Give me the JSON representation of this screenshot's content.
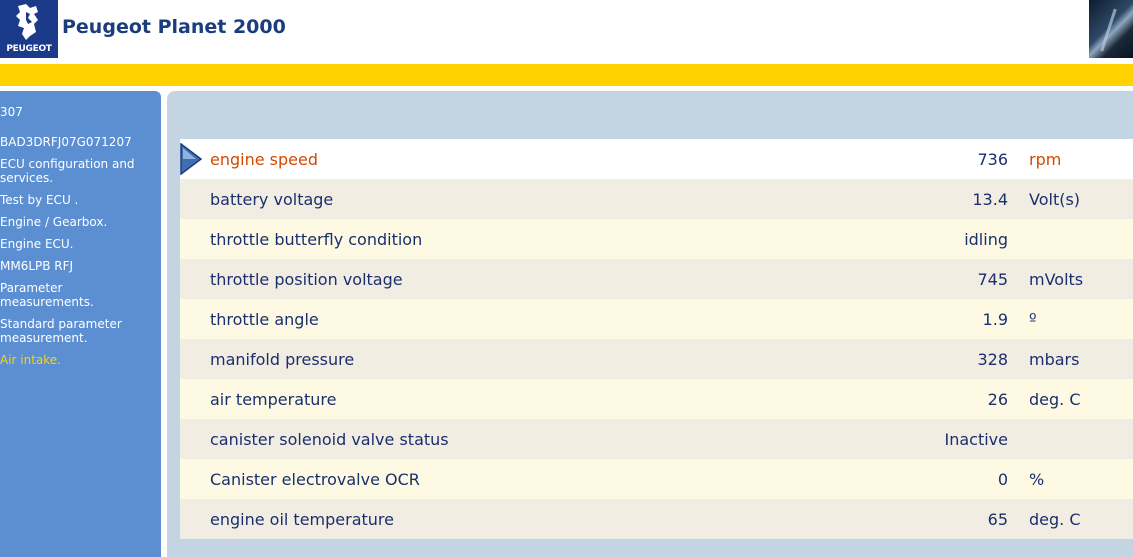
{
  "header": {
    "logo_text": "PEUGEOT",
    "title": "Peugeot Planet 2000"
  },
  "colors": {
    "accent_yellow": "#ffd200",
    "sidebar_blue": "#5b8fd2",
    "panel_blue": "#c3d5e3",
    "highlight": "#d04a00",
    "text_navy": "#1a2f6e"
  },
  "sidebar": {
    "items": [
      {
        "label": "307"
      },
      {
        "label": "BAD3DRFJ07G071207"
      },
      {
        "label": "ECU configuration and services."
      },
      {
        "label": "Test by ECU ."
      },
      {
        "label": "Engine / Gearbox."
      },
      {
        "label": "Engine ECU."
      },
      {
        "label": "MM6LPB RFJ"
      },
      {
        "label": "Parameter measurements."
      },
      {
        "label": "Standard parameter measurement."
      },
      {
        "label": "Air intake."
      }
    ]
  },
  "parameters": [
    {
      "label": "engine speed",
      "value": "736",
      "unit": "rpm"
    },
    {
      "label": "battery voltage",
      "value": "13.4",
      "unit": "Volt(s)"
    },
    {
      "label": "throttle butterfly condition",
      "value": "idling",
      "unit": ""
    },
    {
      "label": "throttle position voltage",
      "value": "745",
      "unit": "mVolts"
    },
    {
      "label": "throttle angle",
      "value": "1.9",
      "unit": "º"
    },
    {
      "label": "manifold pressure",
      "value": "328",
      "unit": "mbars"
    },
    {
      "label": "air temperature",
      "value": "26",
      "unit": "deg. C"
    },
    {
      "label": "canister solenoid valve status",
      "value": "Inactive",
      "unit": ""
    },
    {
      "label": "Canister electrovalve OCR",
      "value": "0",
      "unit": "%"
    },
    {
      "label": "engine oil temperature",
      "value": "65",
      "unit": "deg. C"
    }
  ],
  "icons": {
    "logo": "peugeot-lion-icon",
    "selection": "triangle-right-icon"
  }
}
